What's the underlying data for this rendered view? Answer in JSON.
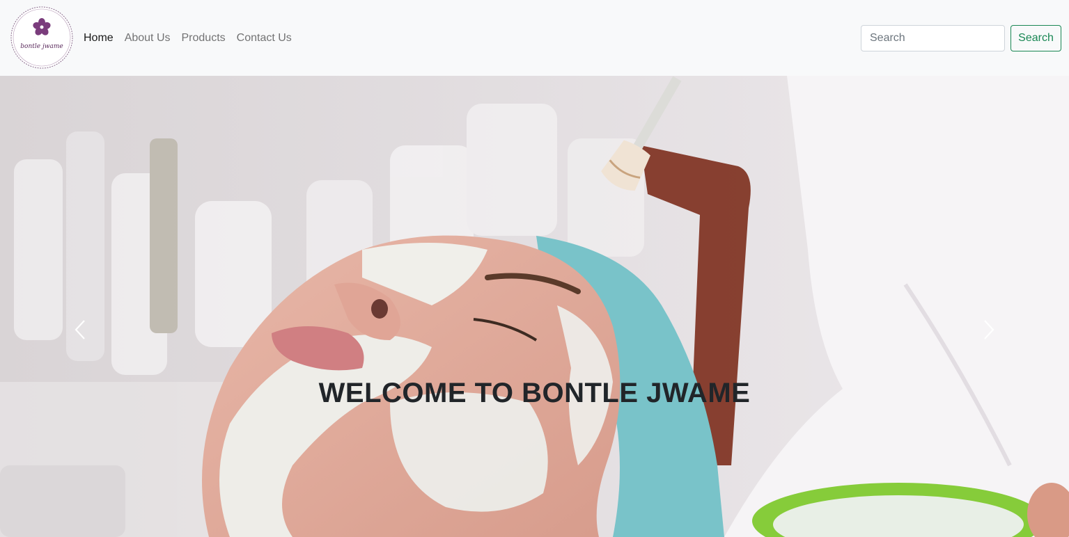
{
  "brand": {
    "logo_text": "bontle jwame",
    "logo_icon": "hibiscus-flower-icon"
  },
  "nav": {
    "items": [
      {
        "label": "Home",
        "active": true
      },
      {
        "label": "About Us",
        "active": false
      },
      {
        "label": "Products",
        "active": false
      },
      {
        "label": "Contact Us",
        "active": false
      }
    ]
  },
  "search": {
    "placeholder": "Search",
    "value": "",
    "button_label": "Search"
  },
  "carousel": {
    "caption": "WELCOME TO BONTLE JWAME",
    "prev_icon": "chevron-left-icon",
    "next_icon": "chevron-right-icon"
  },
  "colors": {
    "accent": "#198754",
    "brand_purple": "#6b2d6e",
    "navbar_bg": "#f8f9fa"
  }
}
